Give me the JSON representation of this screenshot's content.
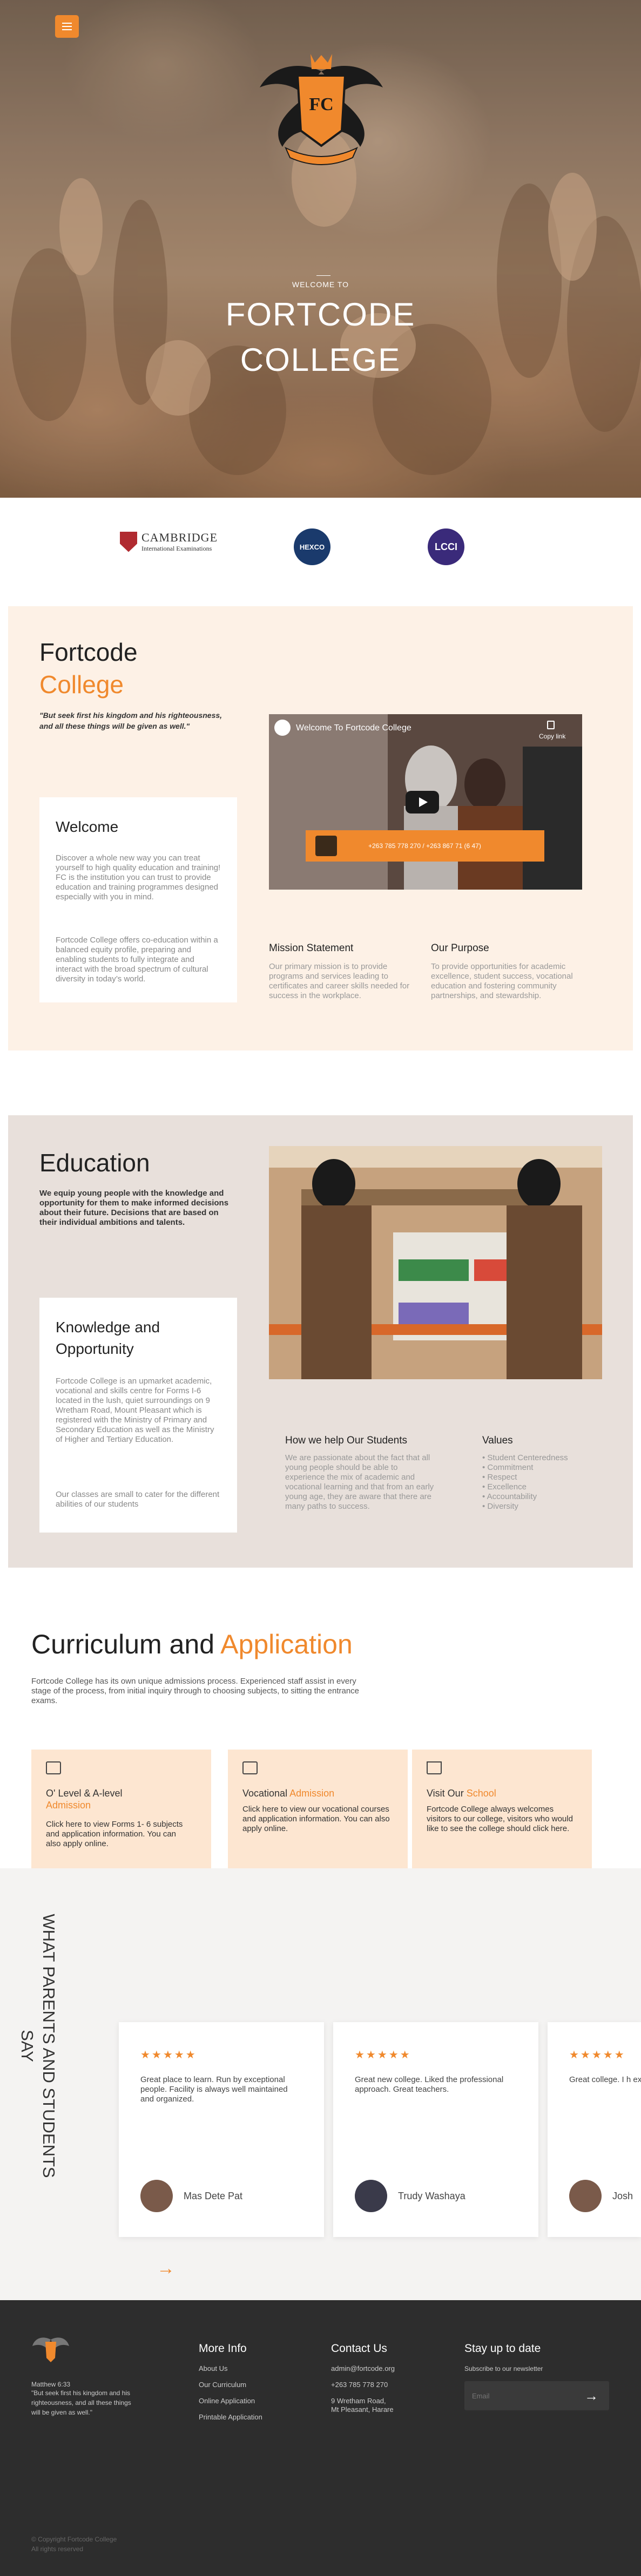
{
  "nav": {
    "menu_label": "≡"
  },
  "hero": {
    "welcome": "WELCOME TO",
    "title_line1": "FORTCODE",
    "title_line2": "COLLEGE",
    "crest_text": "FC"
  },
  "partners": {
    "cambridge_name": "CAMBRIDGE",
    "cambridge_sub": "International Examinations",
    "hexco": "HEXCO",
    "lcci": "LCCI"
  },
  "intro": {
    "title_part1": "Fortcode",
    "title_part2": "College",
    "quote": "\"But seek first his kingdom and his righteousness, and all these things will be given as well.\"",
    "welcome_heading": "Welcome",
    "welcome_p1": "Discover a whole new way you can treat yourself to high quality education and training!  FC is the institution you can trust to provide education and training programmes designed especially with you in mind.",
    "welcome_p2": "Fortcode College offers co-education within a balanced equity profile, preparing and enabling students to fully integrate and interact with the broad spectrum of cultural diversity in today’s world.",
    "video_title": "Welcome To Fortcode College",
    "video_copy": "Copy link",
    "video_phone": "+263 785 778 270 / +263 867 71 (6 47)",
    "mission_heading": "Mission Statement",
    "mission_text": "Our primary mission is to provide programs and services leading to certificates and career skills needed for success in the workplace.",
    "purpose_heading": "Our Purpose",
    "purpose_text": "To provide opportunities for academic excellence, student success, vocational education and fostering community partnerships, and stewardship."
  },
  "education": {
    "title": "Education",
    "intro": "We equip young people with the knowledge and opportunity for them to make informed decisions about their future. Decisions that are based on their individual ambitions and talents.",
    "card_title_part1": "Knowledge and",
    "card_title_part2": "Opportunity",
    "card_p1": "Fortcode College is an upmarket academic, vocational and skills centre for Forms I-6 located in the lush, quiet surroundings on 9 Wretham Road, Mount Pleasant which is registered with the Ministry of Primary and Secondary Education as well as the Ministry of Higher and Tertiary Education.",
    "card_p2": "Our classes are small to cater for the different abilities of our students",
    "help_heading": "How we help Our Students",
    "help_text": "We are passionate about the fact that all young people should be able to experience the mix of academic and vocational learning and that from an early young age, they are aware that there are many paths to success.",
    "values_heading": "Values",
    "values": [
      "• Student Centeredness",
      "• Commitment",
      "• Respect",
      "• Excellence",
      "• Accountability",
      "• Diversity"
    ]
  },
  "curriculum": {
    "title_part1": "Curriculum and",
    "title_part2": "Application",
    "intro": "Fortcode College has its own unique admissions process. Experienced staff assist in every stage of the process, from initial inquiry through to choosing subjects, to sitting the entrance exams.",
    "cards": [
      {
        "label_part1": "O' Level & A-level",
        "label_part2": "Admission",
        "desc": "Click here to view Forms 1- 6 subjects and  application information. You can also apply online."
      },
      {
        "label_part1": "Vocational",
        "label_part2": "Admission",
        "desc": "Click here to view our vocational courses and  application information. You can also apply online."
      },
      {
        "label_part1": "Visit Our",
        "label_part2": "School",
        "desc": "Fortcode College always welcomes visitors to our college, visitors who would like to see the college should click here."
      }
    ]
  },
  "testimonials": {
    "heading": "WHAT PARENTS AND STUDENTS SAY",
    "items": [
      {
        "stars": "★★★★★",
        "quote": "Great place to learn. Run by exceptional people. Facility is always well maintained and organized.",
        "name": "Mas Dete Pat"
      },
      {
        "stars": "★★★★★",
        "quote": "Great new college. Liked the professional approach. Great teachers.",
        "name": "Trudy Washaya"
      },
      {
        "stars": "★★★★★",
        "quote": "Great college. I h experience with th",
        "name": "Josh"
      }
    ],
    "next_arrow": "→"
  },
  "footer": {
    "verse_ref": "Matthew 6:33",
    "verse": "\"But seek first his kingdom and his righteousness, and all these things will be given as well.\"",
    "more_info_heading": "More Info",
    "links": [
      "About Us",
      "Our Curriculum",
      "Online Application",
      "Printable Application"
    ],
    "contact_heading": "Contact Us",
    "email": "admin@fortcode.org",
    "phone": "+263 785 778 270",
    "address_l1": "9 Wretham Road,",
    "address_l2": "Mt Pleasant, Harare",
    "news_heading": "Stay up to date",
    "news_sub": "Subscribe to our newsletter",
    "email_placeholder": "Email",
    "submit_arrow": "→",
    "copyright": "© Copyright Fortcode College",
    "rights": "All rights reserved"
  },
  "colors": {
    "accent": "#f0892d",
    "section_bg1": "#fdf1e6",
    "section_bg2": "#e8e0db",
    "footer_bg": "#2d2d2d"
  }
}
